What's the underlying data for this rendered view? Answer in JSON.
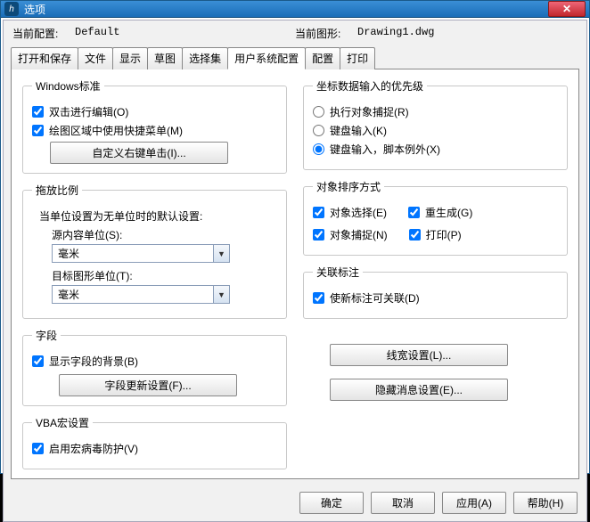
{
  "window": {
    "title": "选项"
  },
  "info": {
    "profile_label": "当前配置:",
    "profile_value": "Default",
    "drawing_label": "当前图形:",
    "drawing_value": "Drawing1.dwg"
  },
  "tabs": [
    "打开和保存",
    "文件",
    "显示",
    "草图",
    "选择集",
    "用户系统配置",
    "配置",
    "打印"
  ],
  "active_tab": 5,
  "left": {
    "windows_std": {
      "legend": "Windows标准",
      "dblclick_edit": "双击进行编辑(O)",
      "shortcut_menu": "绘图区域中使用快捷菜单(M)",
      "custom_rclick_btn": "自定义右键单击(I)..."
    },
    "scale": {
      "legend": "拖放比例",
      "note": "当单位设置为无单位时的默认设置:",
      "source_label": "源内容单位(S):",
      "source_value": "毫米",
      "target_label": "目标图形单位(T):",
      "target_value": "毫米"
    },
    "field": {
      "legend": "字段",
      "show_bg": "显示字段的背景(B)",
      "update_btn": "字段更新设置(F)..."
    },
    "vba": {
      "legend": "VBA宏设置",
      "macro_virus": "启用宏病毒防护(V)"
    }
  },
  "right": {
    "priority": {
      "legend": "坐标数据输入的优先级",
      "opt1": "执行对象捕捉(R)",
      "opt2": "键盘输入(K)",
      "opt3": "键盘输入，脚本例外(X)"
    },
    "sort": {
      "legend": "对象排序方式",
      "sel": "对象选择(E)",
      "regen": "重生成(G)",
      "snap": "对象捕捉(N)",
      "print": "打印(P)"
    },
    "assoc": {
      "legend": "关联标注",
      "assoc_chk": "使新标注可关联(D)"
    },
    "lw_btn": "线宽设置(L)...",
    "hide_btn": "隐藏消息设置(E)..."
  },
  "footer": {
    "ok": "确定",
    "cancel": "取消",
    "apply": "应用(A)",
    "help": "帮助(H)"
  }
}
